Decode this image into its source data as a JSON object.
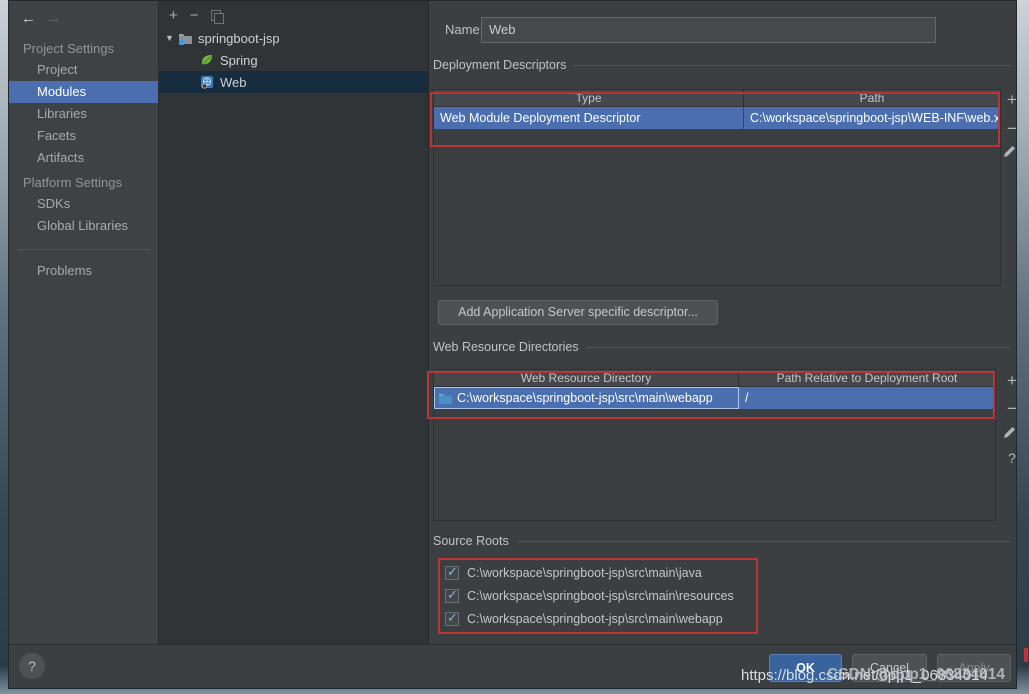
{
  "sidebar": {
    "back_icon": "←",
    "forward_icon": "→",
    "sections": [
      {
        "header": "Project Settings",
        "items": [
          {
            "label": "Project"
          },
          {
            "label": "Modules"
          },
          {
            "label": "Libraries"
          },
          {
            "label": "Facets"
          },
          {
            "label": "Artifacts"
          }
        ]
      },
      {
        "header": "Platform Settings",
        "items": [
          {
            "label": "SDKs"
          },
          {
            "label": "Global Libraries"
          }
        ]
      }
    ],
    "problems_item": "Problems",
    "selected_item": "Modules"
  },
  "tree": {
    "toolbar": {
      "add": "+",
      "remove": "−",
      "copy_icon": "copy"
    },
    "root": {
      "label": "springboot-jsp",
      "caret": "▼"
    },
    "children": [
      {
        "label": "Spring"
      },
      {
        "label": "Web"
      }
    ],
    "selected": "Web"
  },
  "main": {
    "name_label": "Name:",
    "name_value": "Web",
    "deployment_descriptors": {
      "section_title": "Deployment Descriptors",
      "columns": [
        "Type",
        "Path"
      ],
      "rows": [
        {
          "type": "Web Module Deployment Descriptor",
          "path": "C:\\workspace\\springboot-jsp\\WEB-INF\\web.xm"
        }
      ],
      "toolbar": {
        "add": "+",
        "remove": "−",
        "edit": "edit-pencil"
      }
    },
    "add_descriptor_button": "Add Application Server specific descriptor...",
    "web_resource_directories": {
      "section_title": "Web Resource Directories",
      "columns": [
        "Web Resource Directory",
        "Path Relative to Deployment Root"
      ],
      "rows": [
        {
          "directory": "C:\\workspace\\springboot-jsp\\src\\main\\webapp",
          "relative_path": "/"
        }
      ],
      "toolbar": {
        "add": "+",
        "remove": "−",
        "edit": "edit-pencil",
        "help": "?"
      }
    },
    "source_roots": {
      "section_title": "Source Roots",
      "items": [
        {
          "path": "C:\\workspace\\springboot-jsp\\src\\main\\java",
          "checked": true
        },
        {
          "path": "C:\\workspace\\springboot-jsp\\src\\main\\resources",
          "checked": true
        },
        {
          "path": "C:\\workspace\\springboot-jsp\\src\\main\\webapp",
          "checked": true
        }
      ],
      "check_mark": "✓"
    }
  },
  "footer": {
    "help": "?",
    "ok": "OK",
    "cancel": "Cancel",
    "apply": "Apply"
  },
  "watermark": {
    "url": "https://blog.csdn.net/dpp1_06834014",
    "handle": "CSDN @dpp1_06834014"
  },
  "colors": {
    "selection_blue": "#4b6eaf",
    "tree_selection": "#172c3e",
    "annotation_red": "#bd3434",
    "ok_button_blue": "#38639c",
    "panel_gray": "#3c3f41"
  }
}
